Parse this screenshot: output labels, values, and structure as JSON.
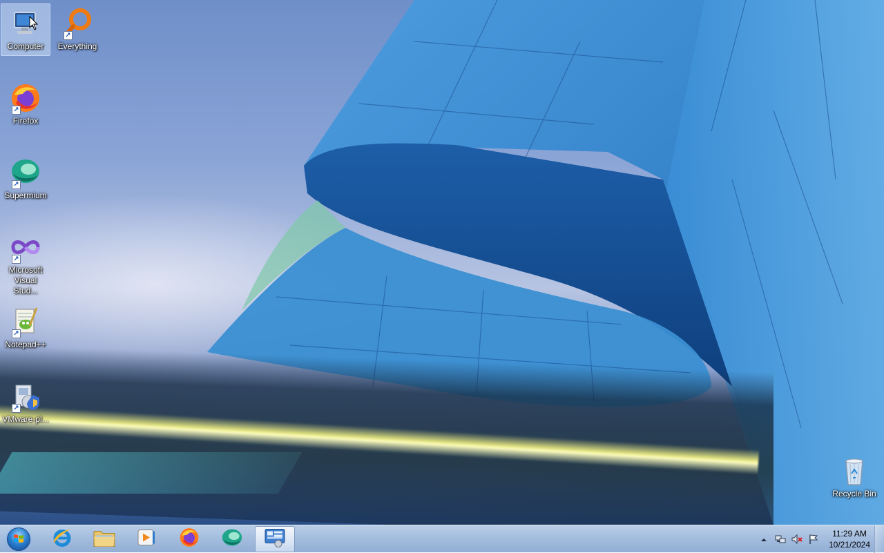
{
  "desktop": {
    "icons": [
      {
        "label": "Computer",
        "icon": "computer-icon"
      },
      {
        "label": "Everything",
        "icon": "everything-search-icon"
      },
      {
        "label": "Firefox",
        "icon": "firefox-icon"
      },
      {
        "label": "Supermium",
        "icon": "supermium-icon"
      },
      {
        "label": "Microsoft Visual Stud...",
        "icon": "visual-studio-icon"
      },
      {
        "label": "Notepad++",
        "icon": "notepadpp-icon"
      },
      {
        "label": "VMware-pl...",
        "icon": "vmware-installer-icon"
      },
      {
        "label": "Recycle Bin",
        "icon": "recycle-bin-icon"
      }
    ]
  },
  "taskbar": {
    "start": {
      "icon": "windows-orb-icon"
    },
    "pinned": [
      {
        "name": "Internet Explorer",
        "icon": "internet-explorer-icon"
      },
      {
        "name": "Windows Explorer",
        "icon": "folder-icon"
      },
      {
        "name": "Windows Media Player",
        "icon": "media-player-icon"
      },
      {
        "name": "Firefox",
        "icon": "firefox-icon"
      },
      {
        "name": "Supermium",
        "icon": "supermium-icon"
      },
      {
        "name": "Control Panel",
        "icon": "control-panel-icon",
        "active": true
      }
    ],
    "tray": {
      "icons": [
        "show-hidden-icons-arrow",
        "network-icon",
        "volume-muted-icon",
        "action-center-flag-icon"
      ],
      "time": "11:29 AM",
      "date": "10/21/2024"
    }
  },
  "colors": {
    "taskbar": "#a5bedf",
    "label_text": "#ffffff",
    "building_blue": "#2f7fc4"
  }
}
